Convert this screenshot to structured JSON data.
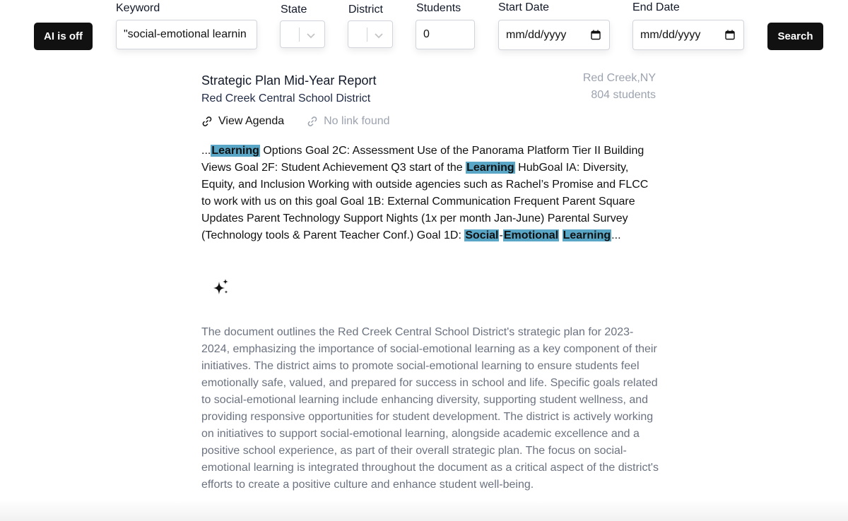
{
  "toolbar": {
    "ai_toggle_label": "AI is off",
    "keyword_label": "Keyword",
    "keyword_value": "\"social-emotional learnin",
    "state_label": "State",
    "district_label": "District",
    "students_label": "Students",
    "students_value": "0",
    "start_date_label": "Start Date",
    "start_date_value": "mm/dd/yyyy",
    "end_date_label": "End Date",
    "end_date_value": "mm/dd/yyyy",
    "search_label": "Search"
  },
  "result": {
    "title": "Strategic Plan Mid-Year Report",
    "district": "Red Creek Central School District",
    "location": "Red Creek,NY",
    "students": "804 students",
    "agenda_link": "View Agenda",
    "no_link": "No link found",
    "snippet": {
      "prefix": "...",
      "hl1": "Learning",
      "t1": " Options Goal 2C: Assessment Use of the Panorama Platform Tier II Building Views Goal 2F: Student Achievement Q3 start of the ",
      "hl2": "Learning",
      "t2": " HubGoal IA: Diversity, Equity, and Inclusion Working with outside agencies such as Rachel’s Promise and FLCC to work with us on this goal Goal 1B: External Communication Frequent Parent Square Updates Parent Technology Support Nights (1x per month Jan-June) Parental Survey (Technology tools & Parent Teacher Conf.) Goal 1D: ",
      "hl3": "Social",
      "t3": "-",
      "hl4": "Emotional",
      "t4": " ",
      "hl5": "Learning",
      "suffix": "..."
    },
    "summary": "The document outlines the Red Creek Central School District's strategic plan for 2023-2024, emphasizing the importance of social-emotional learning as a key component of their initiatives. The district aims to promote social-emotional learning to ensure students feel emotionally safe, valued, and prepared for success in school and life. Specific goals related to social-emotional learning include enhancing diversity, supporting student wellness, and providing responsive opportunities for student development. The district is actively working on initiatives to support social-emotional learning, alongside academic excellence and a positive school experience, as part of their overall strategic plan. The focus on social-emotional learning is integrated throughout the document as a critical aspect of the district's efforts to create a positive culture and enhance student well-being."
  },
  "icons": {
    "link": "link-icon",
    "sparkle": "sparkles-icon",
    "chevron": "chevron-down-icon",
    "calendar": "calendar-icon"
  },
  "colors": {
    "highlight": "#5aa6c6",
    "button_dark": "#111111",
    "muted_text": "#6b7280",
    "location_text": "#9ca3af"
  }
}
